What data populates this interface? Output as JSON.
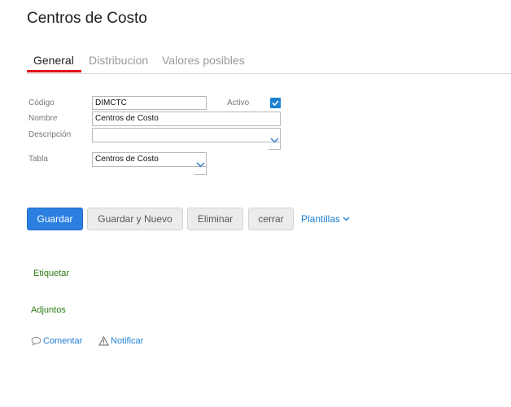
{
  "page": {
    "title": "Centros de Costo"
  },
  "tabs": [
    {
      "label": "General",
      "active": true
    },
    {
      "label": "Distribucion",
      "active": false
    },
    {
      "label": "Valores posibles",
      "active": false
    }
  ],
  "form": {
    "codigo": {
      "label": "Código",
      "value": "DIMCTC"
    },
    "activo": {
      "label": "Activo",
      "checked": true
    },
    "nombre": {
      "label": "Nombre",
      "value": "Centros de Costo"
    },
    "descripcion": {
      "label": "Descripción",
      "value": ""
    },
    "tabla": {
      "label": "Tabla",
      "value": "Centros de Costo"
    }
  },
  "buttons": {
    "guardar": "Guardar",
    "guardar_nuevo": "Guardar y Nuevo",
    "eliminar": "Eliminar",
    "cerrar": "cerrar",
    "plantillas": "Plantillas"
  },
  "links": {
    "etiquetar": "Etiquetar",
    "adjuntos": "Adjuntos",
    "comentar": "Comentar",
    "notificar": "Notificar"
  },
  "icons": {
    "checkbox": "check-icon",
    "dropdown": "chevron-down-icon",
    "comment": "comment-icon",
    "notify": "warning-icon"
  },
  "colors": {
    "accent": "#2b7fe0",
    "tab_underline": "#e0141c",
    "green_link": "#2e7d15"
  }
}
